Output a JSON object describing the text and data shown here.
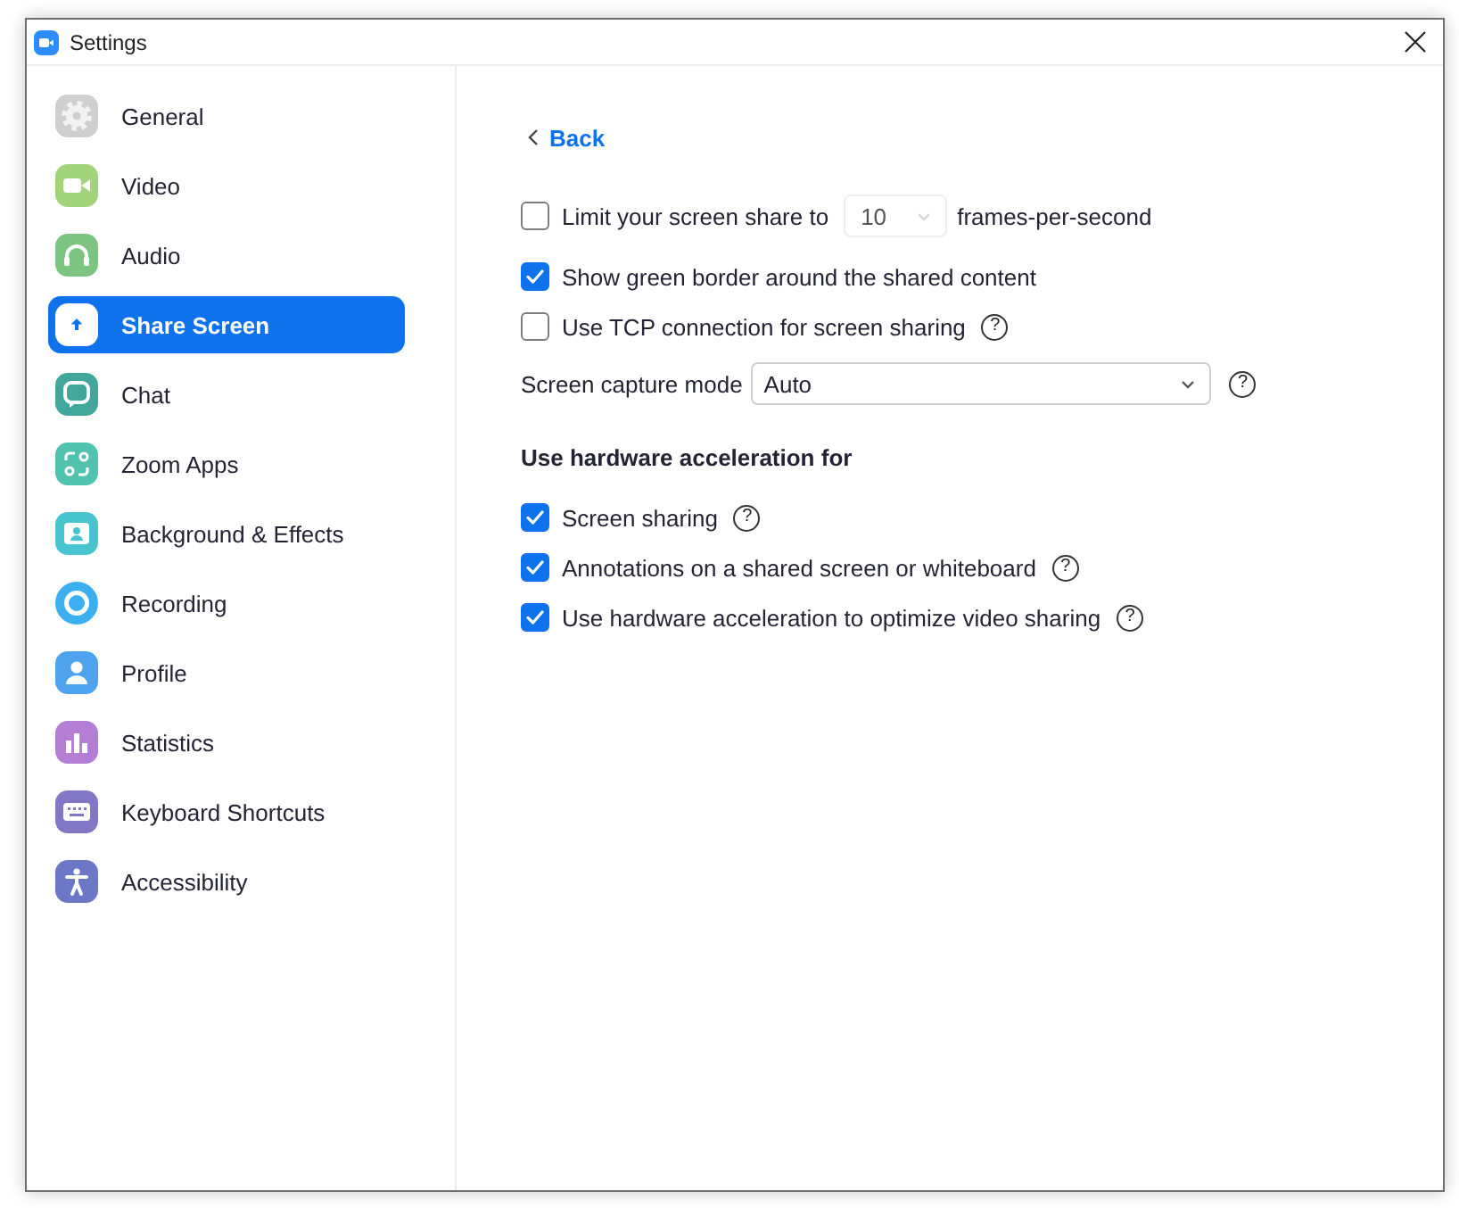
{
  "window": {
    "title": "Settings"
  },
  "sidebar": {
    "items": [
      {
        "label": "General",
        "color": "#cfcfcf",
        "selected": false
      },
      {
        "label": "Video",
        "color": "#a3d47b",
        "selected": false
      },
      {
        "label": "Audio",
        "color": "#7cc480",
        "selected": false
      },
      {
        "label": "Share Screen",
        "color": "#ffffff",
        "selected": true
      },
      {
        "label": "Chat",
        "color": "#41a79c",
        "selected": false
      },
      {
        "label": "Zoom Apps",
        "color": "#4fc2b0",
        "selected": false
      },
      {
        "label": "Background & Effects",
        "color": "#48c4cf",
        "selected": false
      },
      {
        "label": "Recording",
        "color": "#3baff0",
        "selected": false
      },
      {
        "label": "Profile",
        "color": "#4ea3ef",
        "selected": false
      },
      {
        "label": "Statistics",
        "color": "#b47ed4",
        "selected": false
      },
      {
        "label": "Keyboard Shortcuts",
        "color": "#8276c6",
        "selected": false
      },
      {
        "label": "Accessibility",
        "color": "#6b78c8",
        "selected": false
      }
    ]
  },
  "content": {
    "back_link": "Back",
    "options": [
      {
        "kind": "checkbox_with_select",
        "label": "Limit your screen share to",
        "checked": false,
        "select": {
          "value": "10",
          "disabled": true
        },
        "suffix": "frames-per-second"
      },
      {
        "kind": "checkbox",
        "label": "Show green border around the shared content",
        "checked": true
      },
      {
        "kind": "checkbox",
        "label": "Use TCP connection for screen sharing",
        "checked": false,
        "help": "?"
      },
      {
        "kind": "dropdown",
        "label": "Screen capture mode",
        "value": "Auto",
        "help": "?"
      }
    ],
    "hardware_section": {
      "heading": "Use hardware acceleration for",
      "options": [
        {
          "kind": "checkbox",
          "label": "Screen sharing",
          "checked": true,
          "help": "?"
        },
        {
          "kind": "checkbox",
          "label": "Annotations on a shared screen or whiteboard",
          "checked": true,
          "help": "?"
        },
        {
          "kind": "checkbox",
          "label": "Use hardware acceleration to optimize video sharing",
          "checked": true,
          "help": "?"
        }
      ]
    }
  }
}
